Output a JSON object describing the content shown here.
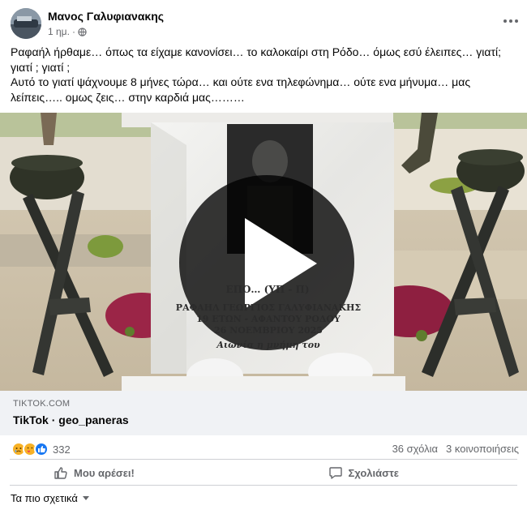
{
  "post": {
    "author": "Μανος Γαλυφιανακης",
    "time": "1 ημ.",
    "separator": "·",
    "caption_lines": [
      "Ραφαήλ ήρθαμε… όπως τα είχαμε κανονίσει… το καλοκαίρι στη Ρόδο… όμως εσύ έλειπες… γιατί;",
      "γιατί ; γιατί ;",
      "Αυτό το γιατί ψάχνουμε 8 μήνες τώρα… και ούτε ενα τηλεφώνημα… ούτε ενα μήνυμα… μας",
      "λείπεις….. ομως ζεις… στην καρδιά μας………"
    ]
  },
  "memorial": {
    "line1": "ΕΠΟ… (ΥΠ - Π)",
    "line2": "ΡΑΦΑΗΛ ΓΕΩΡΓΙΟΣ ΓΑΛΥΦΙΑΝΑΚΗΣ",
    "line3": "19 ΕΤΩΝ - ΑΦΑΝΤΟΥ ΡΟΔΟΥ",
    "line4": "26 ΝΟΕΜΒΡΙΟΥ 2025",
    "line5": "Αιωνία η μνήμη του"
  },
  "link": {
    "domain": "TIKTOK.COM",
    "title": "TikTok · geo_paneras"
  },
  "reactions": {
    "count": "332",
    "comments": "36 σχόλια",
    "shares": "3 κοινοποιήσεις"
  },
  "actions": {
    "like": "Μου αρέσει!",
    "comment": "Σχολιάστε"
  },
  "footer": {
    "relevant": "Τα πιο σχετικά"
  },
  "colors": {
    "link_bg": "#f0f2f5",
    "secondary_text": "#65676b",
    "like_blue": "#1877f2"
  }
}
